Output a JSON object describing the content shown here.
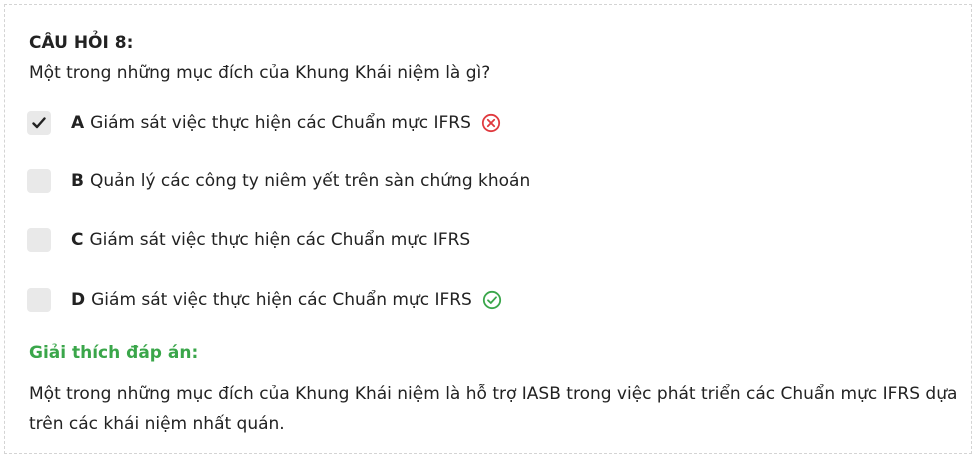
{
  "question": {
    "title": "CÂU HỎI 8:",
    "text": "Một trong những mục đích của Khung Khái niệm là gì?"
  },
  "options": [
    {
      "letter": "A",
      "text": "Giám sát việc thực hiện các Chuẩn mực IFRS",
      "checked": true,
      "status": "wrong",
      "status_icon": "x-circle-icon"
    },
    {
      "letter": "B",
      "text": "Quản lý các công ty niêm yết trên sàn chứng khoán",
      "checked": false,
      "status": "none"
    },
    {
      "letter": "C",
      "text": "Giám sát việc thực hiện các Chuẩn mực IFRS",
      "checked": false,
      "status": "none"
    },
    {
      "letter": "D",
      "text": "Giám sát việc thực hiện các Chuẩn mực IFRS",
      "checked": false,
      "status": "correct",
      "status_icon": "check-circle-icon"
    }
  ],
  "explanation": {
    "title": "Giải thích đáp án:",
    "text": "Một trong những mục đích của Khung Khái niệm là hỗ trợ IASB trong việc phát triển các Chuẩn mực IFRS dựa trên các khái niệm nhất quán."
  },
  "colors": {
    "wrong": "#e0393e",
    "correct": "#3aa64a",
    "checkbox_bg": "#e9e9e9",
    "checkmark": "#222222"
  }
}
